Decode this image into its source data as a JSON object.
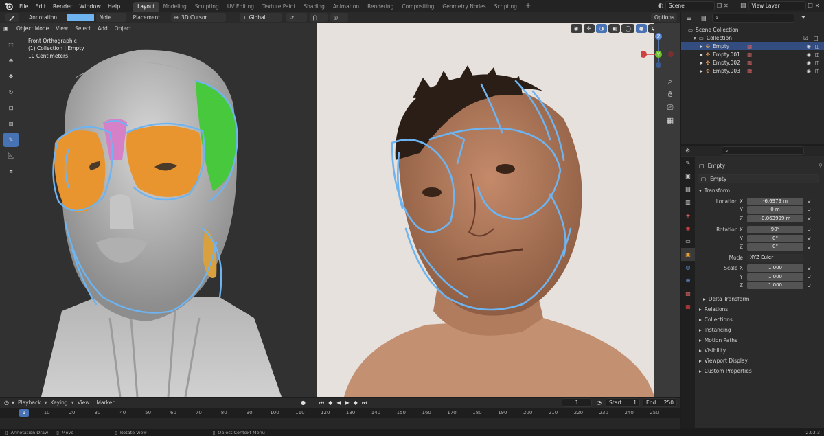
{
  "menu": [
    "File",
    "Edit",
    "Render",
    "Window",
    "Help"
  ],
  "workspaces": [
    "Layout",
    "Modeling",
    "Sculpting",
    "UV Editing",
    "Texture Paint",
    "Shading",
    "Animation",
    "Rendering",
    "Compositing",
    "Geometry Nodes",
    "Scripting"
  ],
  "active_workspace": "Layout",
  "scene": "Scene",
  "view_layer": "View Layer",
  "tool_header": {
    "annotation_label": "Annotation:",
    "note": "Note",
    "placement_label": "Placement:",
    "placement_value": "3D Cursor",
    "orientation": "Global",
    "options": "Options"
  },
  "viewport_header": {
    "mode": "Object Mode",
    "view": "View",
    "select": "Select",
    "add": "Add",
    "object": "Object"
  },
  "overlay": {
    "line1": "Front Orthographic",
    "line2": "(1) Collection | Empty",
    "line3": "10 Centimeters"
  },
  "gizmo": {
    "z": "Z",
    "y": "Y"
  },
  "outliner": {
    "scene_collection": "Scene Collection",
    "collection": "Collection",
    "items": [
      "Empty",
      "Empty.001",
      "Empty.002",
      "Empty.003"
    ]
  },
  "properties": {
    "object_name": "Empty",
    "object_field": "Empty",
    "transform": "Transform",
    "location": {
      "label": "Location X",
      "x": "-6.6979 m",
      "y_label": "Y",
      "y": "0 m",
      "z_label": "Z",
      "z": "-0.063999 m"
    },
    "rotation": {
      "label": "Rotation X",
      "x": "90°",
      "y_label": "Y",
      "y": "0°",
      "z_label": "Z",
      "z": "0°"
    },
    "mode_label": "Mode",
    "mode_value": "XYZ Euler",
    "scale": {
      "label": "Scale X",
      "x": "1.000",
      "y_label": "Y",
      "y": "1.000",
      "z_label": "Z",
      "z": "1.000"
    },
    "delta": "Delta Transform",
    "sections": [
      "Relations",
      "Collections",
      "Instancing",
      "Motion Paths",
      "Visibility",
      "Viewport Display",
      "Custom Properties"
    ]
  },
  "timeline": {
    "playback": "Playback",
    "keying": "Keying",
    "view": "View",
    "marker": "Marker",
    "current_frame": "1",
    "start_label": "Start",
    "start": "1",
    "end_label": "End",
    "end": "250",
    "ruler": [
      "1",
      "10",
      "20",
      "30",
      "40",
      "50",
      "60",
      "70",
      "80",
      "90",
      "100",
      "110",
      "120",
      "130",
      "140",
      "150",
      "160",
      "170",
      "180",
      "190",
      "200",
      "210",
      "220",
      "230",
      "240",
      "250"
    ]
  },
  "status": {
    "draw": "Annotation Draw",
    "move": "Move",
    "rotate": "Rotate View",
    "context": "Object Context Menu",
    "version": "2.93.3"
  },
  "colors": {
    "accent": "#4772b3",
    "annotation": "#6eb4f0",
    "selected_row": "#334d80"
  }
}
